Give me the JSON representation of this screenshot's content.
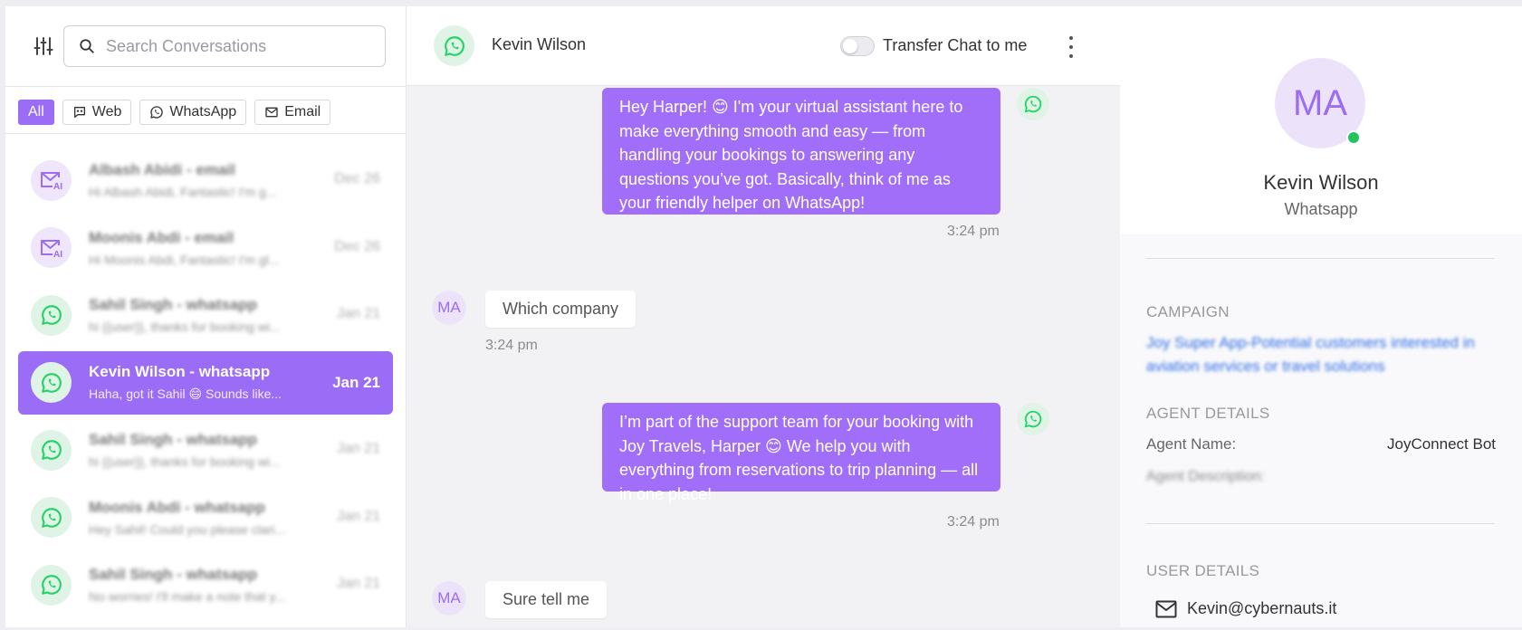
{
  "search": {
    "placeholder": "Search Conversations"
  },
  "tabs": [
    {
      "label": "All"
    },
    {
      "label": "Web"
    },
    {
      "label": "WhatsApp"
    },
    {
      "label": "Email"
    }
  ],
  "conversations": [
    {
      "name": "Albash Abidi - email",
      "preview": "Hi Albash Abidi, Fantastic! I'm g...",
      "date": "Dec 26",
      "channel": "email-ai-icon"
    },
    {
      "name": "Moonis Abdi - email",
      "preview": "Hi Moonis Abdi, Fantastic! I'm gl...",
      "date": "Dec 26",
      "channel": "email-ai-icon"
    },
    {
      "name": "Sahil Singh - whatsapp",
      "preview": "hi {{user}}, thanks for booking wi...",
      "date": "Jan 21",
      "channel": "whatsapp-icon"
    },
    {
      "name": "Kevin Wilson - whatsapp",
      "preview": "Haha, got it Sahil 😄 Sounds like...",
      "date": "Jan 21",
      "channel": "whatsapp-icon"
    },
    {
      "name": "Sahil Singh - whatsapp",
      "preview": "hi {{user}}, thanks for booking wi...",
      "date": "Jan 21",
      "channel": "whatsapp-icon"
    },
    {
      "name": "Moonis Abdi - whatsapp",
      "preview": "Hey Sahil! Could you please clari...",
      "date": "Jan 21",
      "channel": "whatsapp-icon"
    },
    {
      "name": "Sahil Singh - whatsapp",
      "preview": "No worries! I'll make a note that y...",
      "date": "Jan 21",
      "channel": "whatsapp-icon"
    }
  ],
  "chat": {
    "contact_name": "Kevin Wilson",
    "transfer_label": "Transfer Chat to me",
    "transfer_enabled": false,
    "messages": [
      {
        "direction": "outgoing",
        "text": "Hey Harper! 😊 I'm your virtual assistant here to make everything smooth and easy — from handling your bookings to answering any questions you’ve got. Basically, think of me as your friendly helper on WhatsApp!",
        "time": "3:24 pm"
      },
      {
        "direction": "incoming",
        "avatar": "MA",
        "text": "Which company",
        "time": "3:24 pm"
      },
      {
        "direction": "outgoing",
        "text": "I’m part of the support team for your booking with Joy Travels, Harper 😊 We help you with everything from reservations to trip planning — all in one place!",
        "time": "3:24 pm"
      },
      {
        "direction": "incoming",
        "avatar": "MA",
        "text": "Sure tell me",
        "time": ""
      }
    ]
  },
  "profile": {
    "initials": "MA",
    "name": "Kevin Wilson",
    "channel": "Whatsapp",
    "status": "online"
  },
  "details": {
    "campaign_heading": "CAMPAIGN",
    "campaign_text": "Joy Super App-Potential customers interested in aviation services or travel solutions",
    "agent_heading": "AGENT DETAILS",
    "agent_name_label": "Agent Name:",
    "agent_name_value": "JoyConnect Bot",
    "agent_desc_label": "Agent Description:",
    "user_heading": "USER DETAILS",
    "user_email": "Kevin@cybernauts.it"
  },
  "colors": {
    "accent": "#9b6cf6",
    "bubble": "#a06ef8",
    "whatsapp": "#25d366",
    "online": "#21c45d",
    "link": "#2f6ee6"
  }
}
